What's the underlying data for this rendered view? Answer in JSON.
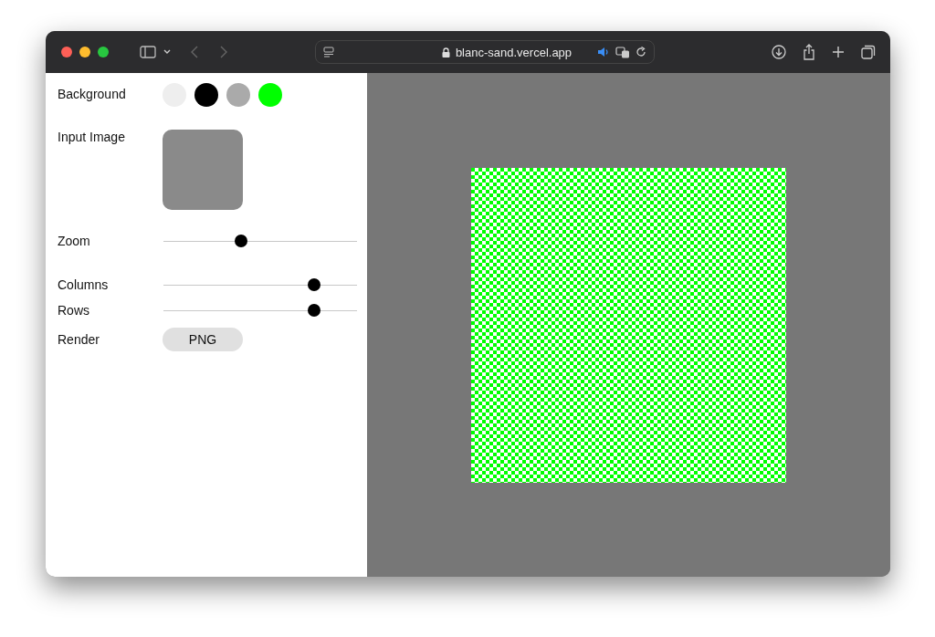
{
  "browser": {
    "url": "blanc-sand.vercel.app"
  },
  "sidebar": {
    "background": {
      "label": "Background",
      "swatches": [
        {
          "color": "#eeeeee"
        },
        {
          "color": "#000000"
        },
        {
          "color": "#aaaaaa"
        },
        {
          "color": "#00ff00"
        }
      ]
    },
    "input_image": {
      "label": "Input Image"
    },
    "sliders": [
      {
        "label": "Zoom",
        "level": 0.4
      },
      {
        "label": "Columns",
        "level": 0.78
      },
      {
        "label": "Rows",
        "level": 0.78
      }
    ],
    "render": {
      "label": "Render",
      "button": "PNG"
    }
  }
}
